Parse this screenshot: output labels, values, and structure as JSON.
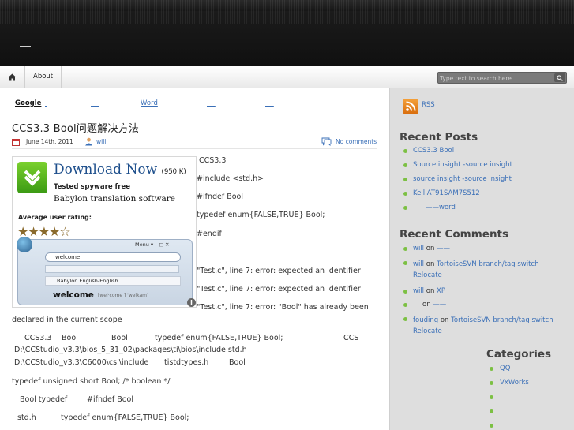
{
  "nav": {
    "about": "About",
    "search_placeholder": "Type text to search here..."
  },
  "toplinks": [
    "Google",
    "Word"
  ],
  "post": {
    "title": "CCS3.3 Bool问题解决方法",
    "date": "June 14th, 2011",
    "author": "will",
    "comments": "No comments",
    "lines": [
      "CCS3.3",
      "#include <std.h>",
      "#ifndef Bool",
      "typedef enum{FALSE,TRUE} Bool;",
      "#endif",
      "\"Test.c\", line 7: error: expected an identifier",
      "\"Test.c\", line 7: error: expected an identifier",
      "\"Test.c\", line 7: error: \"Bool\" has already been",
      "declared in the current scope",
      "CCS3.3",
      "Bool",
      "Bool",
      "typedef enum{FALSE,TRUE} Bool;",
      "CCS",
      "D:\\CCStudio_v3.3\\bios_5_31_02\\packages\\ti\\bios\\include  std.h",
      "D:\\CCStudio_v3.3\\C6000\\csl\\include",
      "tistdtypes.h",
      "Bool",
      "typedef unsigned short Bool; /* boolean */",
      "Bool  typedef",
      "#ifndef Bool",
      "std.h",
      "typedef enum{FALSE,TRUE} Bool;"
    ]
  },
  "ad": {
    "title": "Download Now",
    "size": "(950 K)",
    "line1": "Tested spyware free",
    "line2": "Babylon translation software",
    "rating_label": "Average user rating:",
    "stars": "★★★★☆",
    "rating": 4,
    "menu": "Menu ▾  –  ◻  ✕",
    "search_word": "welcome",
    "dict": "Babylon English-English",
    "word": "welcome",
    "phonetic": "[wel·come ] 'welkam]"
  },
  "sidebar": {
    "rss": "RSS",
    "recent_posts_title": "Recent Posts",
    "recent_posts": [
      "CCS3.3 Bool",
      "Source insight   -source insight",
      "source insight   -source insight",
      "Keil AT91SAM7S512",
      "——word"
    ],
    "recent_comments_title": "Recent Comments",
    "recent_comments": [
      {
        "who": "will",
        "on": "on",
        "what": "——"
      },
      {
        "who": "will",
        "on": "on",
        "what": "TortoiseSVN branch/tag switch Relocate"
      },
      {
        "who": "will",
        "on": "on",
        "what": "XP"
      },
      {
        "who": "",
        "on": "on",
        "what": "——"
      },
      {
        "who": "fouding",
        "on": "on",
        "what": "TortoiseSVN branch/tag switch Relocate"
      }
    ],
    "categories_title": "Categories",
    "categories": [
      "QQ",
      "VxWorks",
      "",
      "",
      ""
    ]
  }
}
